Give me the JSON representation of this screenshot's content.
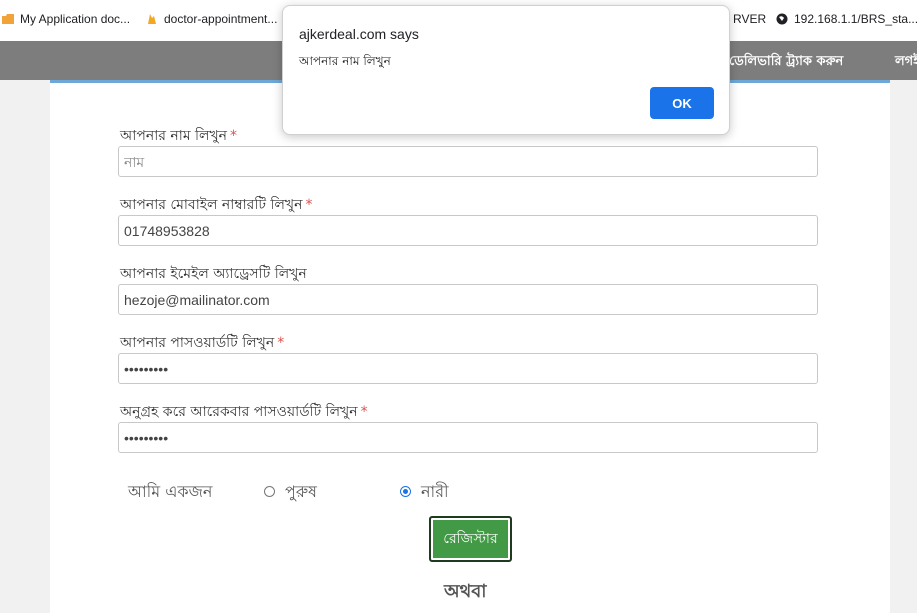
{
  "bookmarks": {
    "items": [
      {
        "label": "My Application doc..."
      },
      {
        "label": "doctor-appointment..."
      },
      {
        "label": "RVER"
      },
      {
        "label": "192.168.1.1/BRS_sta..."
      }
    ]
  },
  "navbar": {
    "track_delivery": "ডেলিভারি ট্র্যাক করুন",
    "login": "লগই"
  },
  "form": {
    "name_label": "আপনার নাম লিখুন",
    "name_placeholder": "নাম",
    "name_value": "",
    "mobile_label": "আপনার মোবাইল নাম্বারটি লিখুন",
    "mobile_value": "01748953828",
    "email_label": "আপনার ইমেইল অ্যাড্রেসটি লিখুন",
    "email_value": "hezoje@mailinator.com",
    "password_label": "আপনার পাসওয়ার্ডটি লিখুন",
    "password_value": "password1",
    "confirm_label": "অনুগ্রহ করে আরেকবার পাসওয়ার্ডটি লিখুন",
    "confirm_value": "password1",
    "required_mark": "*",
    "gender_label": "আমি একজন",
    "gender_male": "পুরুষ",
    "gender_female": "নারী",
    "gender_selected": "নারী",
    "register_button": "রেজিস্টার",
    "or_text": "অথবা"
  },
  "dialog": {
    "title": "ajkerdeal.com says",
    "message": "আপনার নাম লিখুন",
    "ok_label": "OK"
  },
  "colors": {
    "register_green": "#439a46",
    "dialog_button_blue": "#1a73e8",
    "required_red": "#d9534f",
    "navbar_gray": "#7d7d7d"
  }
}
